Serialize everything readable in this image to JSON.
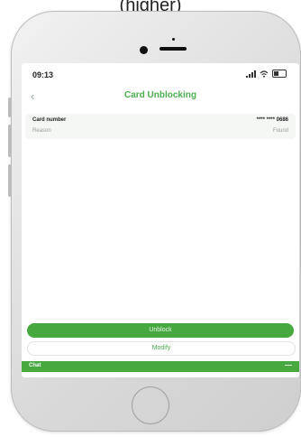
{
  "caption": "(higher)",
  "status": {
    "time": "09:13"
  },
  "nav": {
    "back": "‹",
    "title": "Card Unblocking"
  },
  "card": {
    "rows": [
      {
        "label": "Card number",
        "value": "**** **** 0686"
      },
      {
        "label": "Reason",
        "value": "Found"
      }
    ]
  },
  "actions": {
    "unblock": "Unblock",
    "modify": "Modify"
  },
  "chat": {
    "label": "Chat",
    "toggle": "—"
  },
  "colors": {
    "accent": "#4caf50",
    "button": "#46a83f"
  }
}
